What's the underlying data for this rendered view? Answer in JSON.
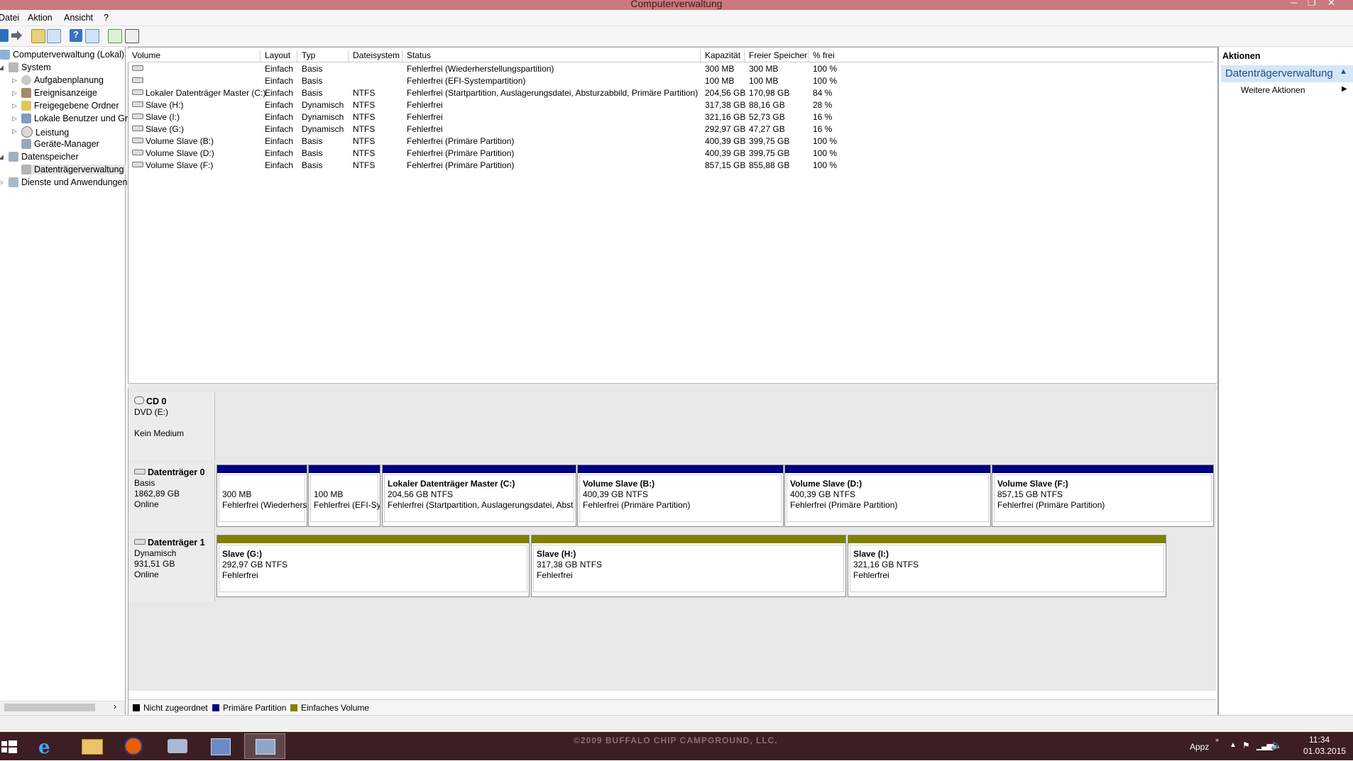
{
  "window": {
    "title": "Computerverwaltung"
  },
  "menu": [
    "Datei",
    "Aktion",
    "Ansicht",
    "?"
  ],
  "toolbar": [
    "back-icon",
    "forward-icon",
    "up-folder-icon",
    "show-hide-tree-icon",
    "help-icon",
    "properties-icon",
    "refresh-icon",
    "export-list-icon"
  ],
  "tree": [
    {
      "label": "Computerverwaltung (Lokal)"
    },
    {
      "label": "System"
    },
    {
      "label": "Aufgabenplanung"
    },
    {
      "label": "Ereignisanzeige"
    },
    {
      "label": "Freigegebene Ordner"
    },
    {
      "label": "Lokale Benutzer und Gr"
    },
    {
      "label": "Leistung"
    },
    {
      "label": "Geräte-Manager"
    },
    {
      "label": "Datenspeicher"
    },
    {
      "label": "Datenträgerverwaltung"
    },
    {
      "label": "Dienste und Anwendungen"
    }
  ],
  "volume_list": {
    "headers": [
      "Volume",
      "Layout",
      "Typ",
      "Dateisystem",
      "Status",
      "Kapazität",
      "Freier Speicher",
      "% frei"
    ],
    "rows": [
      [
        "",
        "Einfach",
        "Basis",
        "",
        "Fehlerfrei (Wiederherstellungspartition)",
        "300 MB",
        "300 MB",
        "100 %"
      ],
      [
        "",
        "Einfach",
        "Basis",
        "",
        "Fehlerfrei (EFI-Systempartition)",
        "100 MB",
        "100 MB",
        "100 %"
      ],
      [
        "Lokaler Datenträger Master (C:)",
        "Einfach",
        "Basis",
        "NTFS",
        "Fehlerfrei (Startpartition, Auslagerungsdatei, Absturzabbild, Primäre Partition)",
        "204,56 GB",
        "170,98 GB",
        "84 %"
      ],
      [
        "Slave (H:)",
        "Einfach",
        "Dynamisch",
        "NTFS",
        "Fehlerfrei",
        "317,38 GB",
        "88,16 GB",
        "28 %"
      ],
      [
        "Slave (I:)",
        "Einfach",
        "Dynamisch",
        "NTFS",
        "Fehlerfrei",
        "321,16 GB",
        "52,73 GB",
        "16 %"
      ],
      [
        "Slave (G:)",
        "Einfach",
        "Dynamisch",
        "NTFS",
        "Fehlerfrei",
        "292,97 GB",
        "47,27 GB",
        "16 %"
      ],
      [
        "Volume Slave (B:)",
        "Einfach",
        "Basis",
        "NTFS",
        "Fehlerfrei (Primäre Partition)",
        "400,39 GB",
        "399,75 GB",
        "100 %"
      ],
      [
        "Volume Slave (D:)",
        "Einfach",
        "Basis",
        "NTFS",
        "Fehlerfrei (Primäre Partition)",
        "400,39 GB",
        "399,75 GB",
        "100 %"
      ],
      [
        "Volume Slave (F:)",
        "Einfach",
        "Basis",
        "NTFS",
        "Fehlerfrei (Primäre Partition)",
        "857,15 GB",
        "855,88 GB",
        "100 %"
      ]
    ]
  },
  "disks": {
    "cd0": {
      "name": "CD 0",
      "line1": "DVD (E:)",
      "line2": "Kein Medium"
    },
    "disk0": {
      "name": "Datenträger 0",
      "type": "Basis",
      "size": "1862,89 GB",
      "state": "Online",
      "partitions": [
        {
          "title": "",
          "size": "300 MB",
          "status": "Fehlerfrei (Wiederhers"
        },
        {
          "title": "",
          "size": "100 MB",
          "status": "Fehlerfrei (EFI-Sy"
        },
        {
          "title": "Lokaler Datenträger Master  (C:)",
          "size": "204,56 GB NTFS",
          "status": "Fehlerfrei (Startpartition, Auslagerungsdatei, Abst"
        },
        {
          "title": "Volume Slave  (B:)",
          "size": "400,39 GB NTFS",
          "status": "Fehlerfrei (Primäre Partition)"
        },
        {
          "title": "Volume Slave  (D:)",
          "size": "400,39 GB NTFS",
          "status": "Fehlerfrei (Primäre Partition)"
        },
        {
          "title": "Volume Slave  (F:)",
          "size": "857,15 GB NTFS",
          "status": "Fehlerfrei (Primäre Partition)"
        }
      ]
    },
    "disk1": {
      "name": "Datenträger 1",
      "type": "Dynamisch",
      "size": "931,51 GB",
      "state": "Online",
      "partitions": [
        {
          "title": "Slave  (G:)",
          "size": "292,97 GB NTFS",
          "status": "Fehlerfrei"
        },
        {
          "title": "Slave  (H:)",
          "size": "317,38 GB NTFS",
          "status": "Fehlerfrei"
        },
        {
          "title": "Slave  (I:)",
          "size": "321,16 GB NTFS",
          "status": "Fehlerfrei"
        }
      ]
    }
  },
  "legend": [
    {
      "label": "Nicht zugeordnet",
      "color": "#000000"
    },
    {
      "label": "Primäre Partition",
      "color": "#000080"
    },
    {
      "label": "Einfaches Volume",
      "color": "#808000"
    }
  ],
  "actions": {
    "title": "Aktionen",
    "section": "Datenträgerverwaltung",
    "more": "Weitere Aktionen"
  },
  "taskbar": {
    "apps": [
      "windows-start-icon",
      "internet-explorer-icon",
      "file-explorer-icon",
      "firefox-icon",
      "app-icon",
      "control-panel-icon",
      "computer-management-icon"
    ],
    "watermark": "©2009 BUFFALO CHIP CAMPGROUND, LLC.",
    "tray_label": "Appz",
    "time": "11:34",
    "date": "01.03.2015"
  },
  "colors": {
    "primary": "#000080",
    "simple": "#808000",
    "titlebar": "#c9797f",
    "taskbar": "#3d1e22"
  }
}
